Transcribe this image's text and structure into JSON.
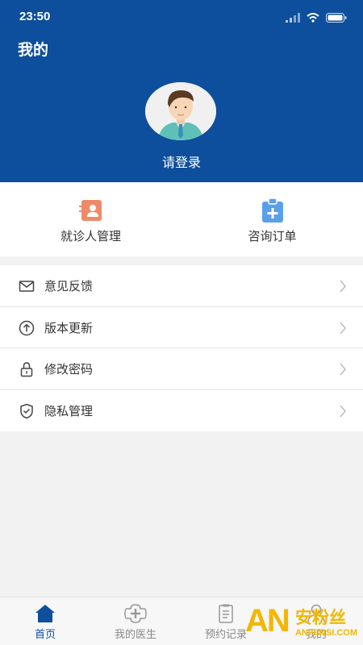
{
  "status_bar": {
    "time": "23:50",
    "signal_icon": "signal-icon",
    "wifi_icon": "wifi-icon",
    "battery_icon": "battery-icon"
  },
  "header": {
    "title": "我的",
    "avatar_icon": "avatar-icon",
    "login_text": "请登录",
    "background_color": "#0d4f9c"
  },
  "quick_actions": [
    {
      "label": "就诊人管理",
      "icon": "patient-card-icon",
      "color": "#ee8a6a"
    },
    {
      "label": "咨询订单",
      "icon": "clipboard-plus-icon",
      "color": "#5aa0e8"
    }
  ],
  "menu": [
    {
      "label": "意见反馈",
      "icon": "mail-icon"
    },
    {
      "label": "版本更新",
      "icon": "upload-circle-icon"
    },
    {
      "label": "修改密码",
      "icon": "lock-icon"
    },
    {
      "label": "隐私管理",
      "icon": "shield-icon"
    }
  ],
  "tabs": [
    {
      "label": "首页",
      "icon": "home-icon",
      "active": true
    },
    {
      "label": "我的医生",
      "icon": "medical-cross-icon",
      "active": false
    },
    {
      "label": "预约记录",
      "icon": "document-icon",
      "active": false
    },
    {
      "label": "我的",
      "icon": "user-icon",
      "active": false
    }
  ],
  "watermark": {
    "letters": "AN",
    "text": "安粉丝",
    "url": "ANFENSI.COM"
  }
}
